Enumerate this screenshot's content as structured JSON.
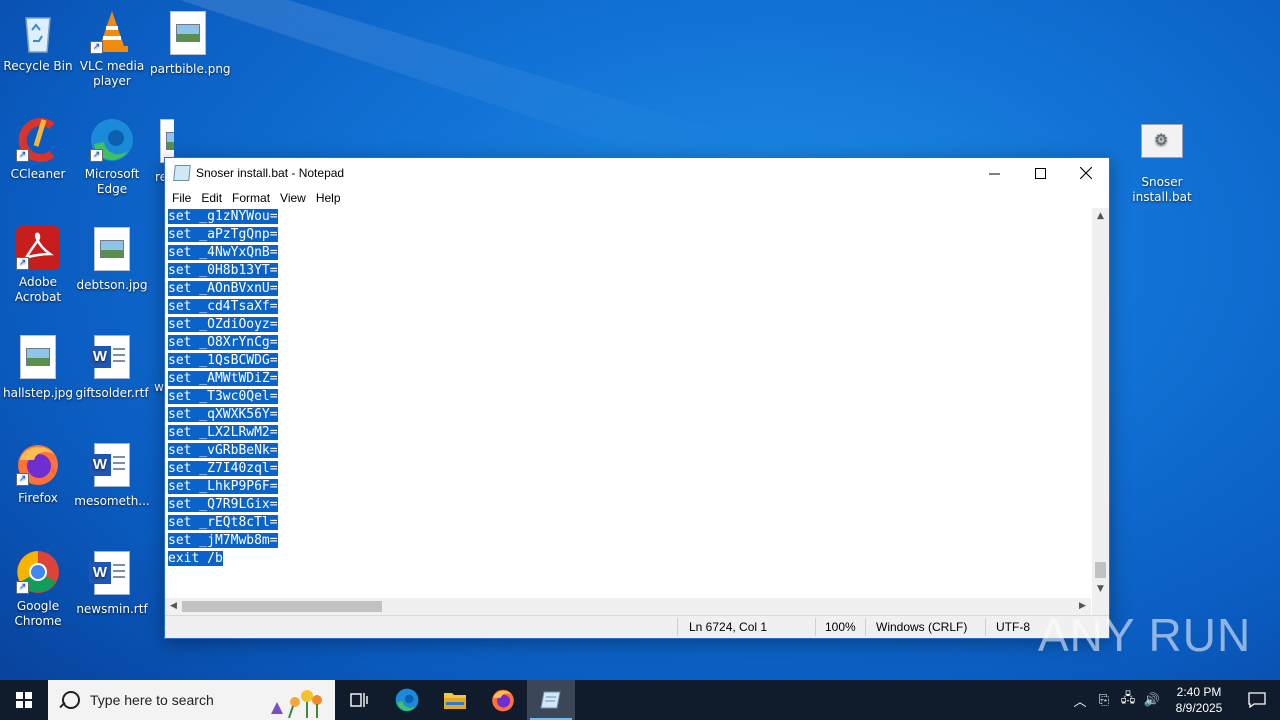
{
  "desktop": {
    "icons": [
      {
        "label": "Recycle Bin"
      },
      {
        "label": "VLC media player"
      },
      {
        "label": "partbible.png"
      },
      {
        "label": "CCleaner"
      },
      {
        "label": "Microsoft Edge"
      },
      {
        "label": "re"
      },
      {
        "label": "Adobe Acrobat"
      },
      {
        "label": "debtson.jpg"
      },
      {
        "label": "hallstep.jpg"
      },
      {
        "label": "giftsolder.rtf"
      },
      {
        "label": "w"
      },
      {
        "label": "Firefox"
      },
      {
        "label": "mesometh..."
      },
      {
        "label": "Google Chrome"
      },
      {
        "label": "newsmin.rtf"
      },
      {
        "label": "Snoser install.bat"
      }
    ]
  },
  "notepad": {
    "title": "Snoser install.bat - Notepad",
    "menu": [
      "File",
      "Edit",
      "Format",
      "View",
      "Help"
    ],
    "lines": [
      "set _g1zNYWou=",
      "set _aPzTgQnp=",
      "set _4NwYxQnB=",
      "set _0H8b13YT=",
      "set _AOnBVxnU=",
      "set _cd4TsaXf=",
      "set _OZdiOoyz=",
      "set _O8XrYnCg=",
      "set _1QsBCWDG=",
      "set _AMWtWDiZ=",
      "set _T3wc0Qel=",
      "set _qXWXK56Y=",
      "set _LX2LRwM2=",
      "set _vGRbBeNk=",
      "set _Z7I40zql=",
      "set _LhkP9P6F=",
      "set _Q7R9LGix=",
      "set _rEQt8cTl=",
      "set _jM7Mwb8m=",
      "exit /b"
    ],
    "status": {
      "position": "Ln 6724, Col 1",
      "zoom": "100%",
      "line_ending": "Windows (CRLF)",
      "encoding": "UTF-8"
    }
  },
  "watermark": "ANY RUN",
  "taskbar": {
    "search_placeholder": "Type here to search",
    "time": "2:40 PM",
    "date": "8/9/2025"
  }
}
